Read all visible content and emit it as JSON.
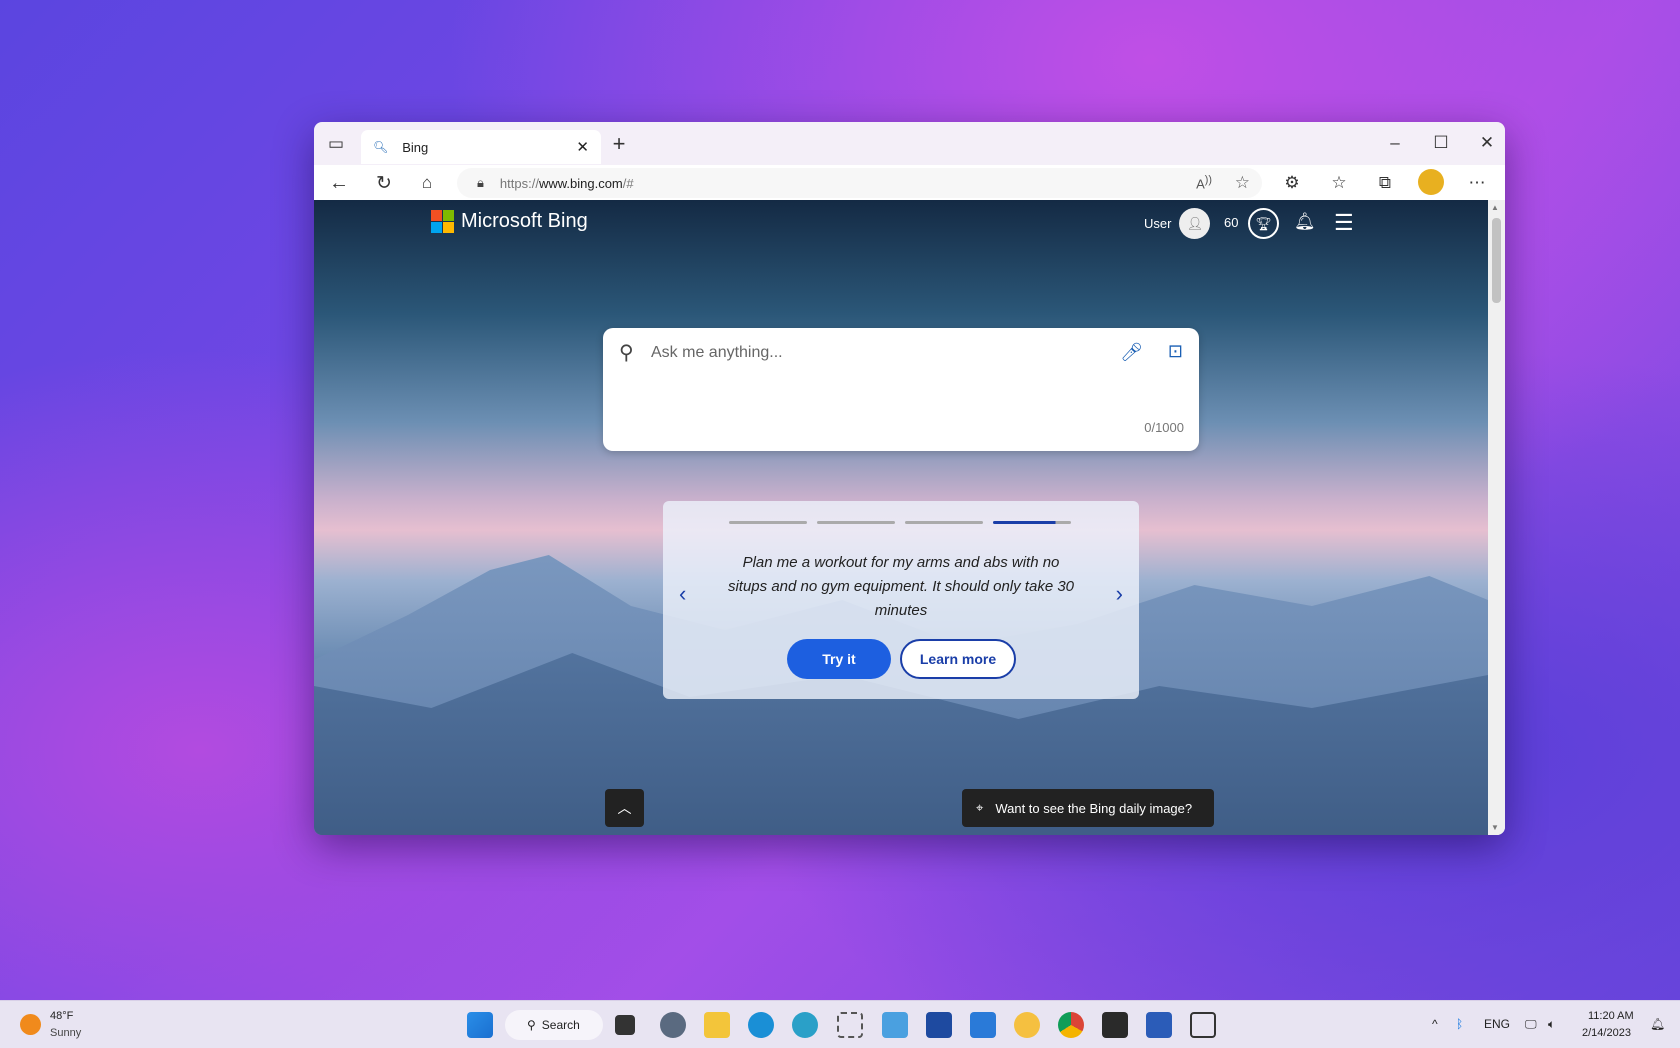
{
  "browser": {
    "tab_title": "Bing",
    "url_scheme": "https://",
    "url_host": "www.bing.com",
    "url_path": "/#"
  },
  "bing": {
    "logo_text": "Microsoft Bing",
    "user_label": "User",
    "rewards_points": "60",
    "search_placeholder": "Ask me anything...",
    "char_count": "0/1000",
    "carousel": {
      "prompt": "Plan me a workout for my arms and abs with no situps and no gym equipment. It should only take 30 minutes",
      "try_label": "Try it",
      "learn_label": "Learn more",
      "slide_index": 4,
      "slide_total": 4
    },
    "daily_image_label": "Want to see the Bing daily image?"
  },
  "taskbar": {
    "weather_temp": "48°F",
    "weather_desc": "Sunny",
    "search_label": "Search",
    "language": "ENG",
    "time": "11:20 AM",
    "date": "2/14/2023"
  },
  "colors": {
    "accent": "#1d5fe0"
  }
}
